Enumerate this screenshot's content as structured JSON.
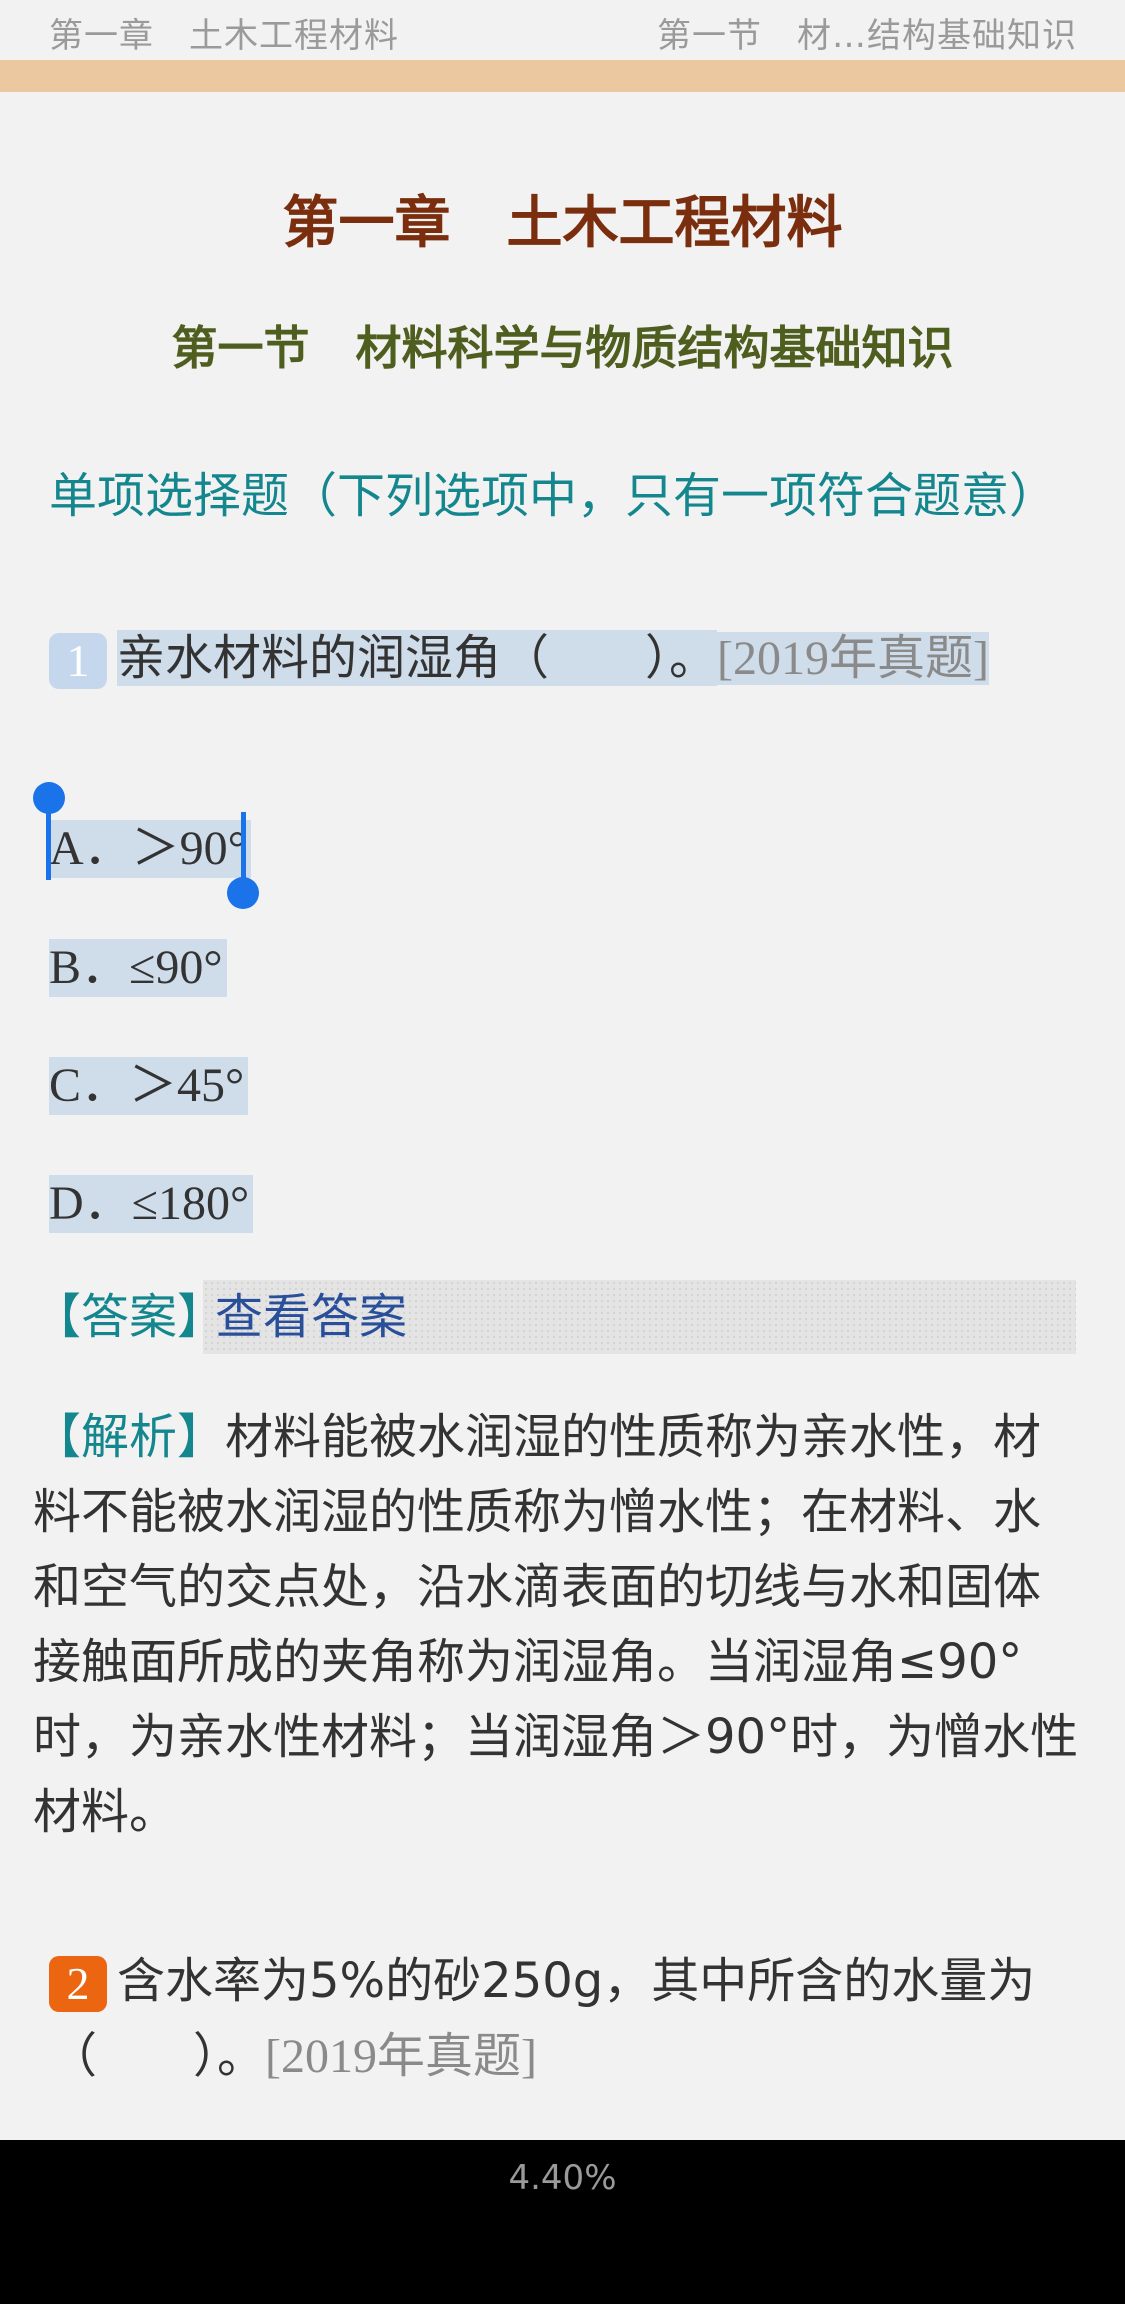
{
  "header": {
    "left": "第一章　土木工程材料",
    "right": "第一节　材…结构基础知识"
  },
  "chapter_title": "第一章　土木工程材料",
  "section_title": "第一节　材料科学与物质结构基础知识",
  "question_type": "单项选择题（下列选项中，只有一项符合题意）",
  "q1": {
    "number": "1",
    "text": "亲水材料的润湿角（　　）。",
    "source": "[2019年真题]",
    "options": [
      "A．＞90°",
      "B．≤90°",
      "C．＞45°",
      "D．≤180°"
    ]
  },
  "answer": {
    "label": "【答案】",
    "link": "查看答案"
  },
  "analysis": {
    "label": "【解析】",
    "text": "材料能被水润湿的性质称为亲水性，材料不能被水润湿的性质称为憎水性；在材料、水和空气的交点处，沿水滴表面的切线与水和固体接触面所成的夹角称为润湿角。当润湿角≤90°时，为亲水性材料；当润湿角＞90°时，为憎水性材料。"
  },
  "q2": {
    "number": "2",
    "text": "含水率为5%的砂250g，其中所含的水量为（　　）。",
    "source": "[2019年真题]"
  },
  "footer": {
    "progress": "4.40%"
  },
  "colors": {
    "chapter": "#7a2e0e",
    "section": "#4e5e1e",
    "teal": "#14868e",
    "selection": "#cfdcea",
    "handle": "#1a73e8",
    "q2_badge": "#ec6510"
  }
}
